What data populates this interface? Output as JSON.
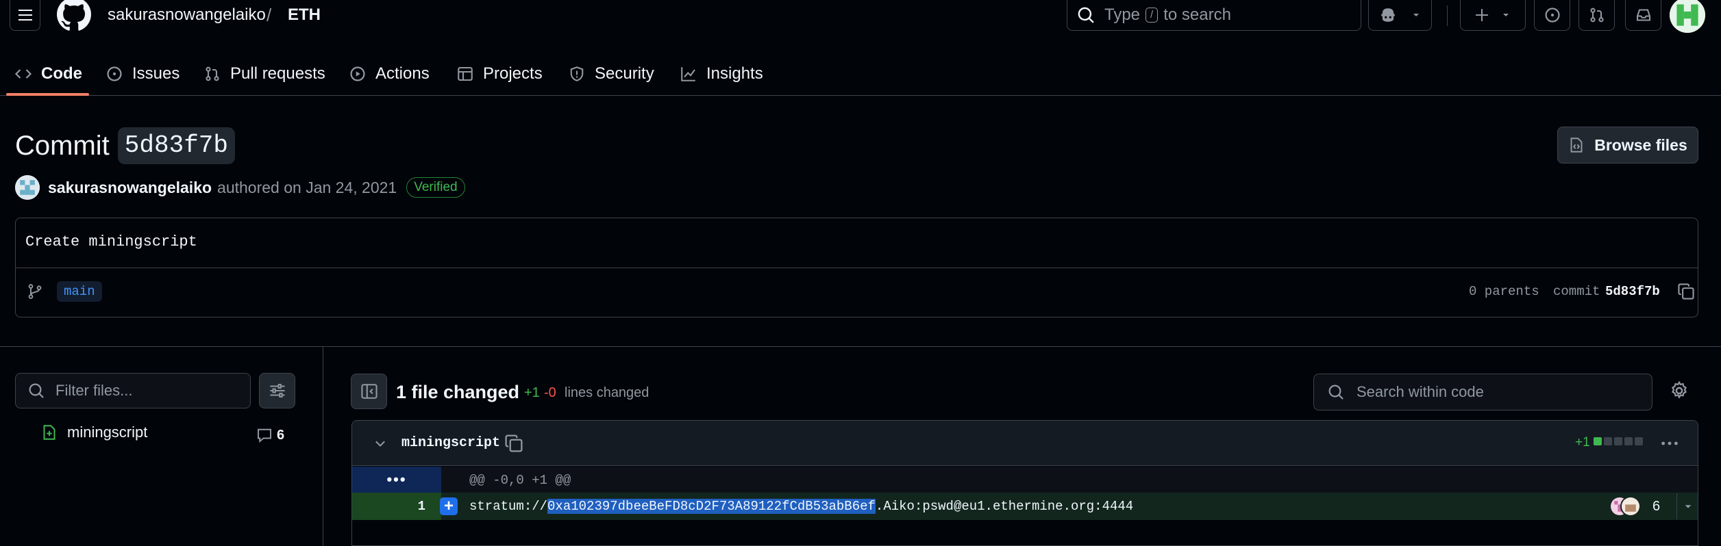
{
  "header": {
    "owner": "sakurasnowangelaiko",
    "separator": "/",
    "repo": "ETH",
    "search_prefix": "Type",
    "search_key": "/",
    "search_suffix": "to search"
  },
  "repo_nav": {
    "items": [
      {
        "label": "Code",
        "icon": "code-icon"
      },
      {
        "label": "Issues",
        "icon": "issue-opened-icon"
      },
      {
        "label": "Pull requests",
        "icon": "git-pull-request-icon"
      },
      {
        "label": "Actions",
        "icon": "play-icon"
      },
      {
        "label": "Projects",
        "icon": "table-icon"
      },
      {
        "label": "Security",
        "icon": "shield-icon"
      },
      {
        "label": "Insights",
        "icon": "graph-icon"
      }
    ],
    "active": "Code"
  },
  "commit": {
    "title_label": "Commit",
    "short_sha": "5d83f7b",
    "browse_files_label": "Browse files",
    "author": "sakurasnowangelaiko",
    "authored_text": "authored on Jan 24, 2021",
    "verified_label": "Verified",
    "message": "Create miningscript",
    "branch": "main",
    "parents_text": "0 parents",
    "commit_label": "commit",
    "commit_sha": "5d83f7b"
  },
  "file_tree": {
    "filter_placeholder": "Filter files...",
    "files": [
      {
        "name": "miningscript",
        "comment_count": "6",
        "status": "added"
      }
    ]
  },
  "diff": {
    "files_changed": "1 file changed",
    "additions": "+1",
    "deletions": "-0",
    "lines_changed_label": "lines changed",
    "search_placeholder": "Search within code",
    "file": {
      "name": "miningscript",
      "stat_additions": "+1",
      "hunk_marker": "•••",
      "hunk_header": "@@ -0,0 +1 @@",
      "line_number": "1",
      "line_prefix": "stratum://",
      "line_selected": "0xa102397dbeeBeFD8cD2F73A89122fCdB53abB6ef",
      "line_suffix": ".Aiko:pswd@eu1.ethermine.org:4444",
      "line_comment_count": "6"
    }
  },
  "colors": {
    "accent": "#1f6feb",
    "added": "#3fb950",
    "removed": "#f85149",
    "underline": "#f78166"
  }
}
